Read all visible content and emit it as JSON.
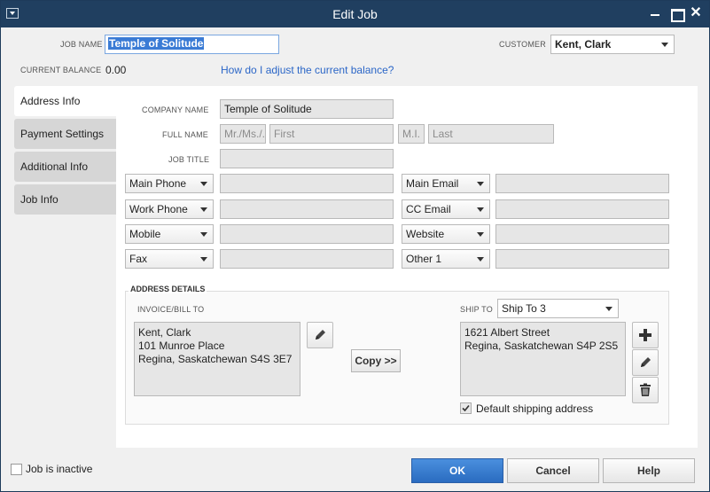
{
  "window": {
    "title": "Edit Job",
    "close_glyph": "✕"
  },
  "header": {
    "job_name_label": "JOB NAME",
    "job_name_value": "Temple of Solitude",
    "customer_label": "CUSTOMER",
    "customer_value": "Kent, Clark",
    "current_balance_label": "CURRENT BALANCE",
    "current_balance_value": "0.00",
    "balance_help_link": "How do I adjust the current balance?"
  },
  "tabs": [
    {
      "label": "Address Info",
      "active": true
    },
    {
      "label": "Payment Settings",
      "active": false
    },
    {
      "label": "Additional Info",
      "active": false
    },
    {
      "label": "Job Info",
      "active": false
    }
  ],
  "form": {
    "company_name_label": "COMPANY NAME",
    "company_name_value": "Temple of Solitude",
    "full_name_label": "FULL NAME",
    "prefix_placeholder": "Mr./Ms./...",
    "first_placeholder": "First",
    "mi_placeholder": "M.I.",
    "last_placeholder": "Last",
    "job_title_label": "JOB TITLE",
    "contact_left": [
      "Main Phone",
      "Work Phone",
      "Mobile",
      "Fax"
    ],
    "contact_right": [
      "Main Email",
      "CC Email",
      "Website",
      "Other 1"
    ]
  },
  "address": {
    "section_label": "ADDRESS DETAILS",
    "bill_to_label": "INVOICE/BILL TO",
    "bill_to_text": "Kent, Clark\n101 Munroe Place\nRegina, Saskatchewan S4S 3E7",
    "copy_button": "Copy >>",
    "ship_to_label": "SHIP TO",
    "ship_to_select": "Ship To 3",
    "ship_to_text": "1621 Albert Street\nRegina, Saskatchewan S4P 2S5",
    "default_shipping_label": "Default shipping address",
    "default_shipping_checked": true
  },
  "footer": {
    "inactive_label": "Job is inactive",
    "ok_button": "OK",
    "cancel_button": "Cancel",
    "help_button": "Help"
  },
  "colors": {
    "titlebar": "#203f60",
    "link": "#2b66c7",
    "primary_button": "#2a6cc0"
  }
}
